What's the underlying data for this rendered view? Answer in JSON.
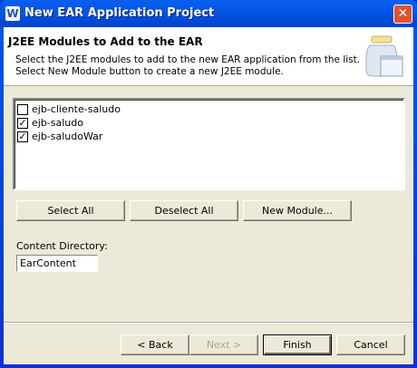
{
  "window": {
    "title": "New EAR Application Project",
    "close_icon": "close-icon",
    "app_icon": "app-icon"
  },
  "banner": {
    "title": "J2EE Modules to Add to the EAR",
    "description_line1": "Select the J2EE modules to add to the new EAR application from the list.",
    "description_line2": "Select New Module button to create a new J2EE module."
  },
  "modules": [
    {
      "label": "ejb-cliente-saludo",
      "checked": false
    },
    {
      "label": "ejb-saludo",
      "checked": true
    },
    {
      "label": "ejb-saludoWar",
      "checked": true
    }
  ],
  "buttons": {
    "select_all": "Select All",
    "deselect_all": "Deselect All",
    "new_module": "New Module..."
  },
  "content_directory": {
    "label": "Content Directory:",
    "value": "EarContent"
  },
  "footer": {
    "back": "< Back",
    "next": "Next >",
    "finish": "Finish",
    "cancel": "Cancel"
  }
}
